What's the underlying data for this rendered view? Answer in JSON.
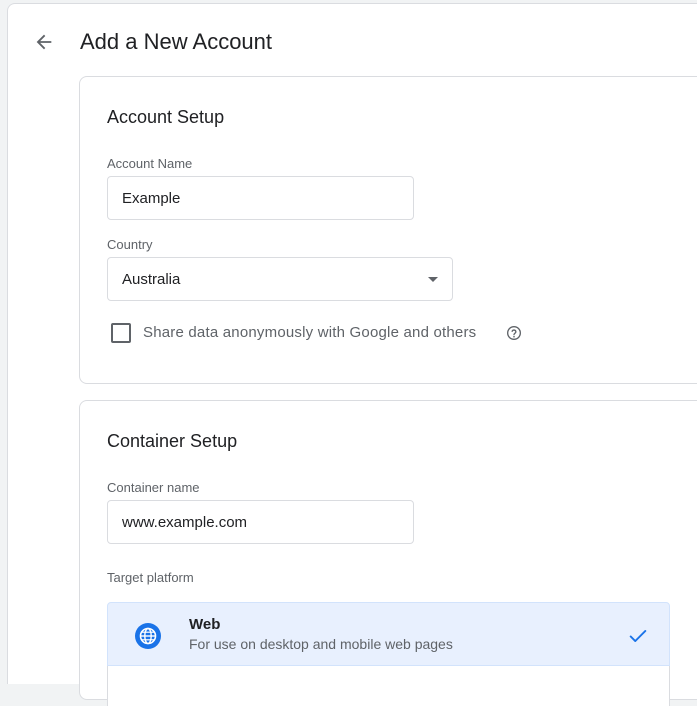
{
  "header": {
    "title": "Add a New Account",
    "back_icon": "arrow-back-icon"
  },
  "account_setup": {
    "title": "Account Setup",
    "account_name_label": "Account Name",
    "account_name_value": "Example",
    "country_label": "Country",
    "country_value": "Australia",
    "share_data_label": "Share data anonymously with Google and others",
    "share_data_checked": false,
    "help_icon": "help-circle-icon"
  },
  "container_setup": {
    "title": "Container Setup",
    "container_name_label": "Container name",
    "container_name_value": "www.example.com",
    "target_platform_label": "Target platform",
    "platforms": [
      {
        "name": "Web",
        "description": "For use on desktop and mobile web pages",
        "icon": "globe-icon",
        "selected": true
      }
    ]
  },
  "colors": {
    "accent": "#1a73e8",
    "selected_bg": "#e8f0fe",
    "text_primary": "#202124",
    "text_secondary": "#5f6368",
    "border": "#dadce0"
  }
}
